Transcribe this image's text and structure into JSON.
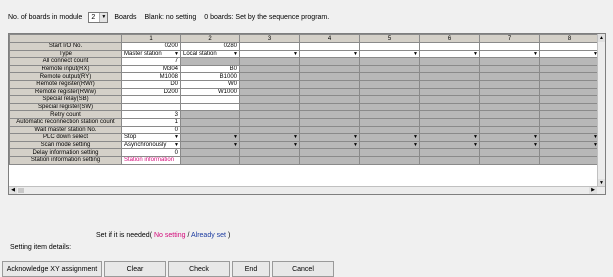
{
  "top": {
    "boards_label": "No. of boards in module",
    "boards_value": "2",
    "boards_unit": "Boards",
    "note_blank": "Blank: no setting",
    "note_zero": "0 boards: Set by the sequence program."
  },
  "grid": {
    "columns": [
      "1",
      "2",
      "3",
      "4",
      "5",
      "6",
      "7",
      "8"
    ],
    "row_labels": {
      "start_io": "Start I/O No.",
      "type": "Type",
      "all_connect": "All connect count",
      "rx": "Remote input(RX)",
      "ry": "Remote output(RY)",
      "rwr": "Remote register(RWr)",
      "rww": "Remote register(RWw)",
      "sb": "Special relay(SB)",
      "sw": "Special register(SW)",
      "retry": "Retry count",
      "auto_reconnect": "Automatic reconnection station count",
      "wait_master": "Wait master station No.",
      "plc_down": "PLC down select",
      "scan_mode": "Scan mode setting",
      "delay": "Delay information setting",
      "station_info": "Station information setting"
    },
    "c1": {
      "start_io": "0200",
      "type": "Master station",
      "all_connect": "7",
      "rx": "M304",
      "ry": "M1008",
      "rwr": "D0",
      "rww": "D200",
      "retry": "3",
      "auto_reconnect": "1",
      "wait_master": "0",
      "plc_down": "Stop",
      "scan_mode": "Asynchronously",
      "delay": "0",
      "station_info": "Station information"
    },
    "c2": {
      "start_io": "0280",
      "type": "Local station",
      "rx": "B0",
      "ry": "B1000",
      "rwr": "W0",
      "rww": "W1000"
    }
  },
  "legend": {
    "prefix": "Set if it is needed(",
    "no_setting": "No setting",
    "sep": "/",
    "already_set": "Already set",
    "suffix": ")"
  },
  "details_label": "Setting item details:",
  "buttons": {
    "ack": "Acknowledge XY assignment",
    "clear": "Clear",
    "check": "Check",
    "end": "End",
    "cancel": "Cancel"
  },
  "colors": {
    "header_gray": "#d4d0c8",
    "disabled_gray": "#b8b8b8",
    "pink": "#d40a7a",
    "blue": "#1a3aa0"
  }
}
